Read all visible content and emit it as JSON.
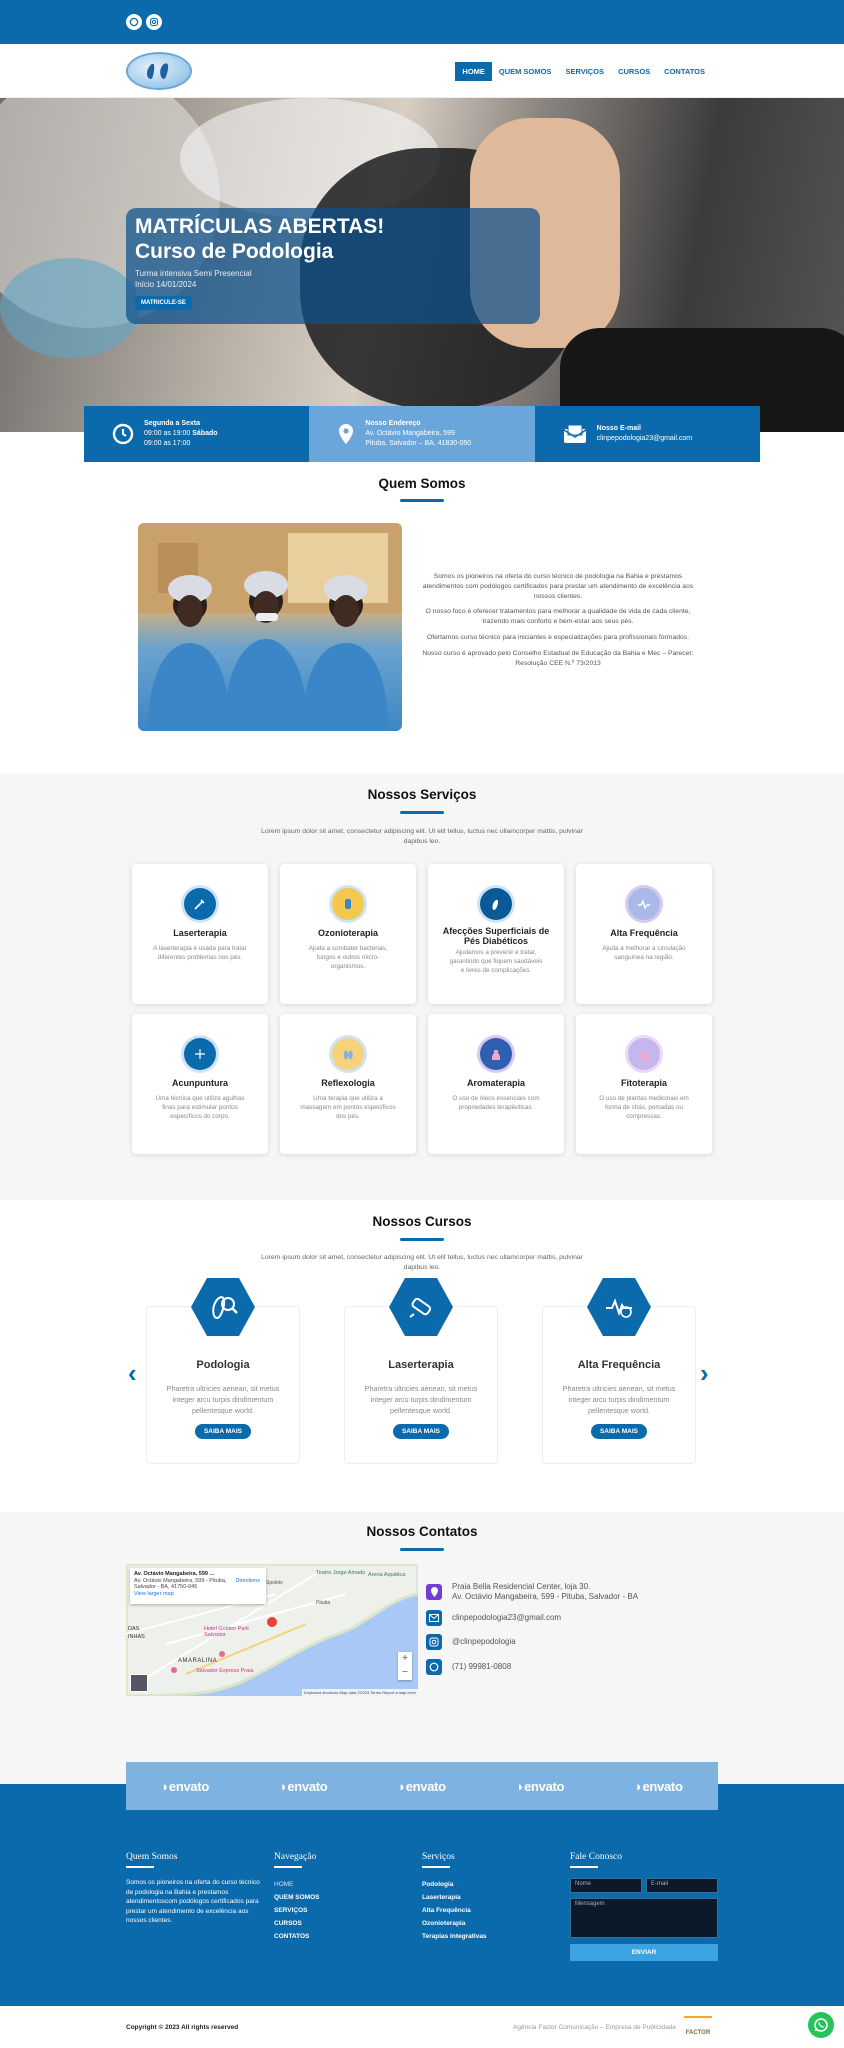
{
  "colors": {
    "primary": "#0b6aab",
    "light_blue": "#6aa6d9",
    "bg_gray": "#f6f6f7"
  },
  "topbar": {
    "icons": [
      "whatsapp-icon",
      "instagram-icon"
    ]
  },
  "nav": {
    "items": [
      {
        "label": "HOME"
      },
      {
        "label": "QUEM SOMOS"
      },
      {
        "label": "SERVIÇOS"
      },
      {
        "label": "CURSOS"
      },
      {
        "label": "CONTATOS"
      }
    ]
  },
  "hero": {
    "line1": "MATRÍCULAS ABERTAS!",
    "line2": "Curso de Podologia",
    "sub1": "Turma intensiva Semi Presencial",
    "sub2": "Início 14/01/2024",
    "button": "MATRICULE-SE"
  },
  "info": {
    "hours": {
      "title": "Segunda a Sexta",
      "line1_a": "09:00 as 19:00 ",
      "line1_b": "Sábado",
      "line2": "09:00 as 17:00"
    },
    "address": {
      "title": "Nosso Endereço",
      "line1": "Av. Octávio Mangabeira, 599",
      "line2": "Pituba, Salvador – BA, 41830-050"
    },
    "email": {
      "title": "Nosso E-mail",
      "line1": "clinpepodologia23@gmail.com"
    }
  },
  "about": {
    "title": "Quem Somos",
    "paragraphs": [
      "Somos os pioneiros na oferta do curso técnico de podologia na Bahia e prestamos atendimentos com podólogos certificados para prestar um atendimento de excelência aos nossos clientes.",
      "O nosso foco é oferecer tratamentos para melhorar a qualidade de vida de cada cliente, trazendo mais conforto e bem-estar aos seus pés.",
      "Ofertamos curso técnico para iniciantes e especializações para profissionais formados.",
      "Nosso curso é aprovado pelo Conselho Estadual de Educação da Bahia e Mec – Parecer: Resolução CEE N.º 73/2013"
    ]
  },
  "services": {
    "title": "Nossos Serviços",
    "lead": "Lorem ipsum dolor sit amet, consectetur adipiscing elit. Ut elit tellus, luctus nec ullamcorper mattis, pulvinar dapibus leo.",
    "items": [
      {
        "name": "Laserterapia",
        "desc": "A laserterapia é usada para tratar diferentes problemas nos pés.",
        "icon": "laser-icon"
      },
      {
        "name": "Ozonioterapia",
        "desc": "Ajuda a combater bactérias, fungos e outros micro-organismos.",
        "icon": "ozone-icon"
      },
      {
        "name": "Afecções  Superficiais de Pés Diabéticos",
        "desc": "Ajudamos a prevenir e tratar, garantindo que fiquem saudáveis e livres de complicações.",
        "icon": "foot-care-icon"
      },
      {
        "name": "Alta Frequência",
        "desc": "Ajuda a melhorar a circulação sanguínea na região.",
        "icon": "high-frequency-icon"
      },
      {
        "name": "Acunpuntura",
        "desc": "Uma técnica que utiliza agulhas finas para estimular pontos específicos do corpo.",
        "icon": "acupuncture-icon"
      },
      {
        "name": "Reflexologia",
        "desc": "Uma terapia que utiliza a massagem em pontos específicos dos pés.",
        "icon": "reflexology-icon"
      },
      {
        "name": "Aromaterapia",
        "desc": "O uso de óleos essenciais com propriedades terapêuticas.",
        "icon": "aromatherapy-icon"
      },
      {
        "name": "Fitoterapia",
        "desc": "O uso de plantas medicinais em forma de chás, pomadas ou compressas.",
        "icon": "phytotherapy-icon"
      }
    ]
  },
  "courses": {
    "title": "Nossos Cursos",
    "lead": "Lorem ipsum dolor sit amet, consectetur adipiscing elit. Ut elit tellus, luctus nec ullamcorper mattis, pulvinar dapibus leo.",
    "items": [
      {
        "name": "Podologia",
        "desc": "Pharetra ultricies aenean, sit metus integer arcu turpis dindimentum pellentesque world.",
        "button": "SAIBA MAIS"
      },
      {
        "name": "Laserterapia",
        "desc": "Pharetra ultricies aenean, sit metus integer arcu turpis dindimentum pellentesque world.",
        "button": "SAIBA MAIS"
      },
      {
        "name": "Alta Frequência",
        "desc": "Pharetra ultricies aenean, sit metus integer arcu turpis dindimentum pellentesque world.",
        "button": "SAIBA MAIS"
      }
    ]
  },
  "contacts": {
    "title": "Nossos Contatos",
    "address1": "Praia Bella Residencial Center, loja 30.",
    "address2": "Av. Octávio Mangabeira, 599 - Pituba, Salvador - BA",
    "email": "clinpepodologia23@gmail.com",
    "instagram": "@clinpepodologia",
    "phone": "(71) 99981-0808",
    "map": {
      "place": "Av. Octávio Mangabeira, 599 ...",
      "addr1": "Av. Octávio Mangabeira, 599 - Pituba,",
      "addr2": "Salvador - BA, 41750-045",
      "directions": "Directions",
      "larger": "View larger map",
      "labels": {
        "teatro": "Teatro Jorge Amado",
        "arena": "Arena Aquática",
        "hotel": "Hotel Golden Park Salvador",
        "amaralina": "AMARALINA",
        "das": "DAS",
        "inhas": "INHAS",
        "spoleto": "Spoleto",
        "pituba": "Pituba",
        "salvador": "Salvador Express Praia"
      },
      "footer": "Keyboard shortcuts   Map data ©2023   Terms   Report a map error"
    }
  },
  "brands": [
    "envato",
    "envato",
    "envato",
    "envato",
    "envato"
  ],
  "footer": {
    "about": {
      "title": "Quem Somos",
      "text": "Somos os pioneiros na oferta do curso técnico de podologia na Bahia e prestamos atendimentoscom podólogos certificados para prestar um atendimento de excelência aos nossos clientes."
    },
    "nav": {
      "title": "Navegação",
      "items": [
        "HOME",
        "QUEM SOMOS",
        "SERVIÇOS",
        "CURSOS",
        "CONTATOS"
      ]
    },
    "services": {
      "title": "Serviços",
      "items": [
        "Podologia",
        "Laserterapia",
        "Alta Frequência",
        "Ozonioterapia",
        "Terapias Integrativas"
      ]
    },
    "contact": {
      "title": "Fale Conosco",
      "name": "Nome",
      "email": "E-mail",
      "message": "Mensagem",
      "button": "ENVIAR"
    }
  },
  "copyright": {
    "text": "Copyright © 2023 All rights reserved",
    "agency": "Agência Factor Comunicação – Empresa de Publicidade",
    "agency_logo": "FACTOR"
  }
}
